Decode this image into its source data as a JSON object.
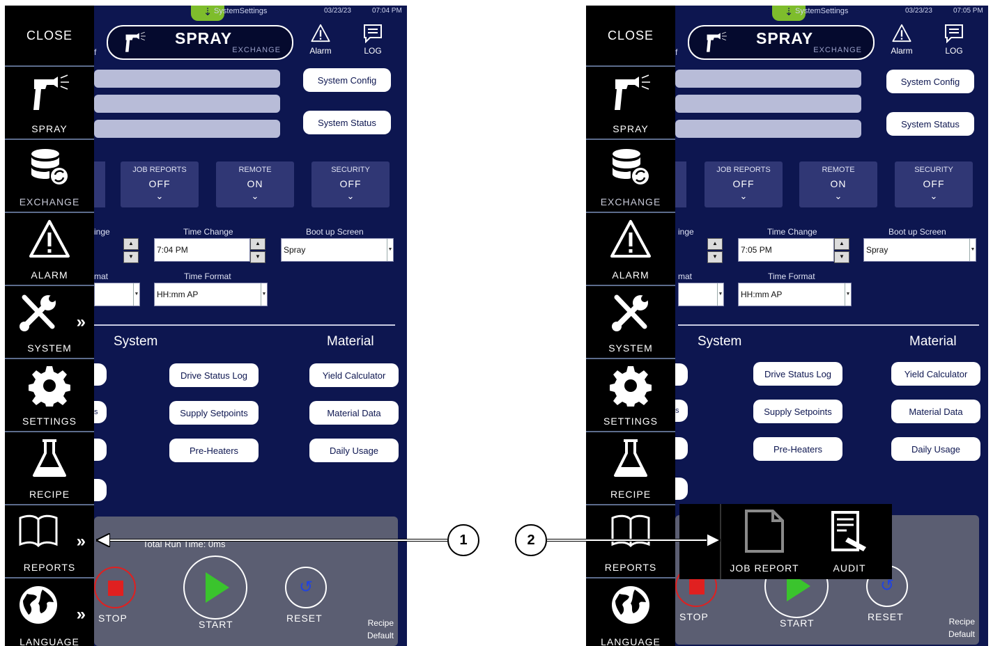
{
  "screens": [
    {
      "topbar": {
        "page": "SystemSettings",
        "date": "03/23/23",
        "time": "07:04 PM"
      },
      "header": {
        "logo_main": "SPRAY",
        "logo_sub": "EXCHANGE",
        "alarm_label": "Alarm",
        "log_label": "LOG",
        "fragment": "f"
      },
      "buttons": {
        "system_config": "System Config",
        "system_status": "System Status"
      },
      "toggles": [
        {
          "label": "JOB REPORTS",
          "value": "OFF"
        },
        {
          "label": "REMOTE",
          "value": "ON"
        },
        {
          "label": "SECURITY",
          "value": "OFF"
        }
      ],
      "fields": {
        "date_change_partial": "inge",
        "time_change_label": "Time Change",
        "time_change_value": "7:04 PM",
        "boot_label": "Boot up Screen",
        "boot_value": "Spray",
        "date_format_partial": "mat",
        "time_format_label": "Time Format",
        "time_format_value": "HH:mm AP"
      },
      "sections": {
        "system": "System",
        "material": "Material"
      },
      "system_buttons": [
        "Drive Status Log",
        "Supply Setpoints",
        "Pre-Heaters"
      ],
      "material_buttons": [
        "Yield Calculator",
        "Material Data",
        "Daily Usage"
      ],
      "side_fragment": "s",
      "run_time": "Total Run Time: 0ms",
      "controls": {
        "stop": "STOP",
        "start": "START",
        "reset": "RESET"
      },
      "recipe": {
        "label": "Recipe",
        "value": "Default"
      }
    },
    {
      "topbar": {
        "page": "SystemSettings",
        "date": "03/23/23",
        "time": "07:05 PM"
      },
      "header": {
        "logo_main": "SPRAY",
        "logo_sub": "EXCHANGE",
        "alarm_label": "Alarm",
        "log_label": "LOG",
        "fragment": "f"
      },
      "buttons": {
        "system_config": "System Config",
        "system_status": "System Status"
      },
      "toggles": [
        {
          "label": "JOB REPORTS",
          "value": "OFF"
        },
        {
          "label": "REMOTE",
          "value": "ON"
        },
        {
          "label": "SECURITY",
          "value": "OFF"
        }
      ],
      "fields": {
        "date_change_partial": "inge",
        "time_change_label": "Time Change",
        "time_change_value": "7:05 PM",
        "boot_label": "Boot up Screen",
        "boot_value": "Spray",
        "date_format_partial": "mat",
        "time_format_label": "Time Format",
        "time_format_value": "HH:mm AP"
      },
      "sections": {
        "system": "System",
        "material": "Material"
      },
      "system_buttons": [
        "Drive Status Log",
        "Supply Setpoints",
        "Pre-Heaters"
      ],
      "material_buttons": [
        "Yield Calculator",
        "Material Data",
        "Daily Usage"
      ],
      "side_fragment": "s",
      "controls": {
        "stop": "STOP",
        "start": "START",
        "reset": "RESET"
      },
      "recipe": {
        "label": "Recipe",
        "value": "Default"
      },
      "flyout": {
        "job_report": "JOB REPORT",
        "audit": "AUDIT"
      }
    }
  ],
  "sidebar": {
    "close": "CLOSE",
    "items": [
      {
        "label": "SPRAY",
        "icon": "spray-gun-icon"
      },
      {
        "label": "EXCHANGE",
        "icon": "database-sync-icon"
      },
      {
        "label": "ALARM",
        "icon": "warning-icon"
      },
      {
        "label": "SYSTEM",
        "icon": "tools-icon"
      },
      {
        "label": "SETTINGS",
        "icon": "gear-icon"
      },
      {
        "label": "RECIPE",
        "icon": "flask-icon"
      },
      {
        "label": "REPORTS",
        "icon": "book-icon"
      },
      {
        "label": "LANGUAGE",
        "icon": "globe-icon"
      }
    ]
  },
  "callouts": [
    "1",
    "2"
  ],
  "colors": {
    "background": "#0d1650",
    "sidebar": "#000000",
    "accent_green": "#7ebd2c",
    "stop_red": "#e02020",
    "start_green": "#3ac42d"
  }
}
